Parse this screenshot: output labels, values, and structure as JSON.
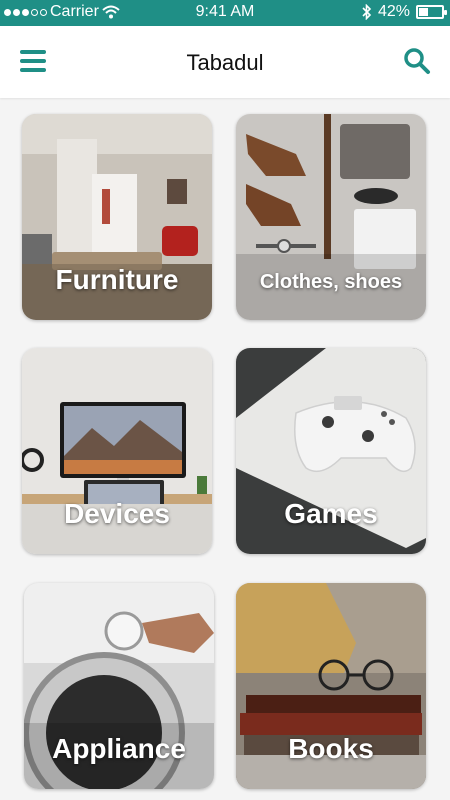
{
  "status_bar": {
    "carrier": "Carrier",
    "time": "9:41 AM",
    "battery": "42%",
    "battery_level": 0.42
  },
  "app_bar": {
    "title": "Tabadul"
  },
  "categories": [
    {
      "label": "Furniture"
    },
    {
      "label": "Clothes, shoes"
    },
    {
      "label": "Devices"
    },
    {
      "label": "Games"
    },
    {
      "label": "Appliance"
    },
    {
      "label": "Books"
    }
  ],
  "colors": {
    "accent": "#1f8f86"
  }
}
